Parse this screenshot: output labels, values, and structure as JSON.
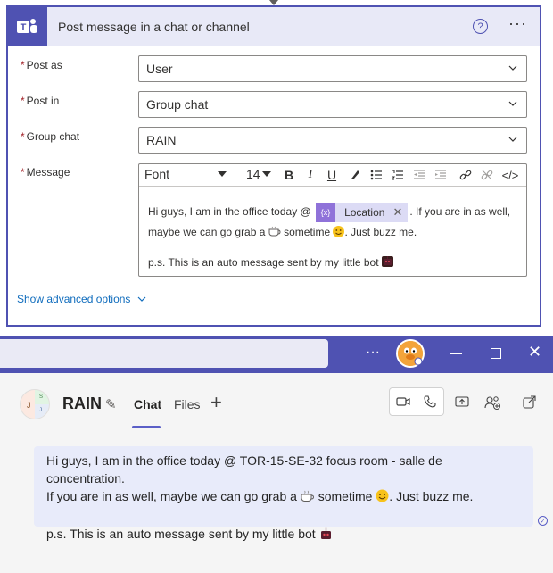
{
  "flow_card": {
    "title": "Post message in a chat or channel",
    "help_glyph": "?",
    "more_glyph": "···",
    "fields": [
      {
        "label": "Post as",
        "value": "User"
      },
      {
        "label": "Post in",
        "value": "Group chat"
      },
      {
        "label": "Group chat",
        "value": "RAIN"
      }
    ],
    "message_label": "Message",
    "required_mark": "*",
    "toolbar": {
      "font": "Font",
      "size": "14",
      "bold": "B",
      "italic": "I",
      "underline": "U",
      "code": "</>"
    },
    "message": {
      "part1": "Hi guys, I am in the office today @",
      "token_label": "Location",
      "token_icon": "{x}",
      "part2": ". If you are in as well, maybe we can go grab a",
      "part3": "sometime",
      "part4": ". Just buzz me.",
      "ps": "p.s. This is an auto message sent by my little bot"
    },
    "advanced_link": "Show advanced options"
  },
  "teams": {
    "title_bar": {
      "more": "···",
      "close": "✕"
    },
    "chat_name": "RAIN",
    "group_avatar_letters": [
      "J",
      "S",
      "J"
    ],
    "tabs": {
      "chat": "Chat",
      "files": "Files",
      "add": "+"
    },
    "message": {
      "line1": "Hi guys, I am in the office today @ TOR-15-SE-32 focus room - salle de concentration.",
      "line2a": "If you are in as well, maybe we can go grab a",
      "line2b": "sometime",
      "line2c": ". Just buzz me.",
      "line3": "p.s. This is an auto message sent by my little bot"
    },
    "seen_glyph": "✓"
  },
  "colors": {
    "accent": "#4f52b2",
    "teams_purple": "#5b5fc7",
    "token_bg": "#dcdbf5",
    "token_icon": "#8f72d9",
    "required": "#a4262c",
    "link": "#0f6cbd",
    "bubble": "#e8ebfa"
  }
}
